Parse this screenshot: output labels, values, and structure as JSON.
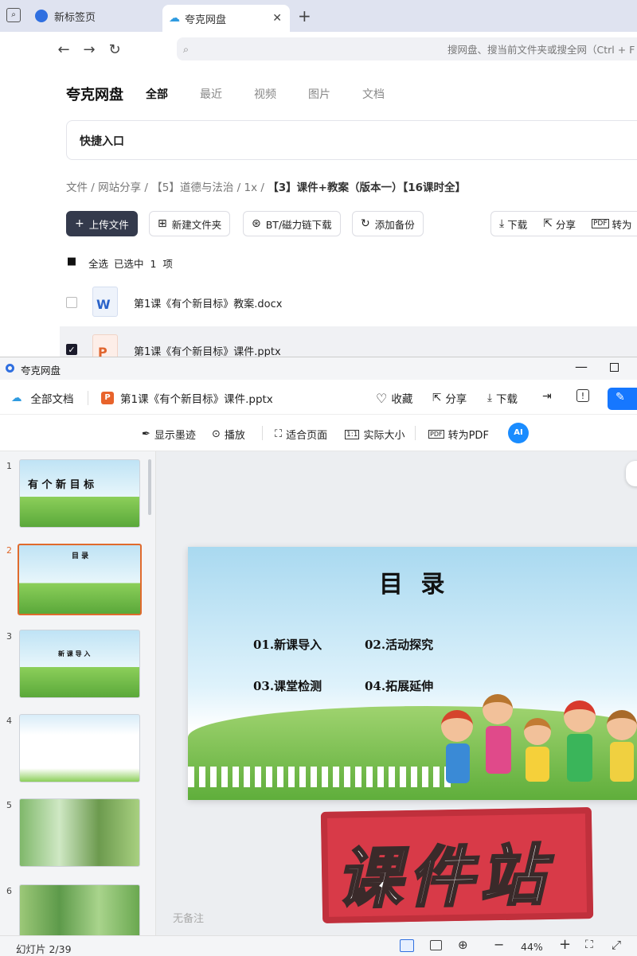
{
  "browser": {
    "tabs": [
      {
        "label": "新标签页",
        "icon": "globe-icon"
      },
      {
        "label": "夸克网盘",
        "icon": "cloud-icon",
        "active": true
      }
    ],
    "search_placeholder": "搜网盘、搜当前文件夹或搜全网（Ctrl + F"
  },
  "drive": {
    "brand": "夸克网盘",
    "tabs": [
      "全部",
      "最近",
      "视频",
      "图片",
      "文档"
    ],
    "quick_entry": "快捷入口",
    "breadcrumb": [
      "文件",
      "网站分享",
      "【5】道德与法治",
      "1x",
      "【3】课件+教案（版本一）【16课时全】"
    ],
    "toolbar": {
      "upload": "上传文件",
      "new_folder": "新建文件夹",
      "bt": "BT/磁力链下载",
      "backup": "添加备份",
      "download": "下载",
      "share": "分享",
      "convert": "转为"
    },
    "select_all": "全选",
    "selected_text": "已选中  1  项",
    "files": [
      {
        "name": "第1课《有个新目标》教案.docx",
        "type": "docx",
        "checked": false
      },
      {
        "name": "第1课《有个新目标》课件.pptx",
        "type": "pptx",
        "checked": true
      }
    ]
  },
  "viewer": {
    "window_title": "夸克网盘",
    "all_docs": "全部文档",
    "file_name": "第1课《有个新目标》课件.pptx",
    "actions": {
      "favorite": "收藏",
      "share": "分享",
      "download": "下载"
    },
    "tools": {
      "ink": "显示墨迹",
      "play": "播放",
      "fit": "适合页面",
      "actual": "实际大小",
      "pdf": "转为PDF"
    },
    "thumbnails": [
      {
        "num": "1",
        "text": "有 个 新 目 标"
      },
      {
        "num": "2",
        "text": "目 录"
      },
      {
        "num": "3",
        "text": "新 课 导 入"
      },
      {
        "num": "4",
        "text": ""
      },
      {
        "num": "5",
        "text": ""
      },
      {
        "num": "6",
        "text": ""
      }
    ],
    "slide": {
      "title": "目 录",
      "items": [
        "01.新课导入",
        "02.活动探究",
        "03.课堂检测",
        "04.拓展延伸"
      ]
    },
    "watermark": "课件站",
    "notes": "无备注",
    "status": {
      "page": "幻灯片 2/39",
      "zoom": "44%"
    },
    "colors": {
      "accent": "#1677ff",
      "selected_thumb": "#e06a2d",
      "stamp": "#d83a48"
    }
  }
}
